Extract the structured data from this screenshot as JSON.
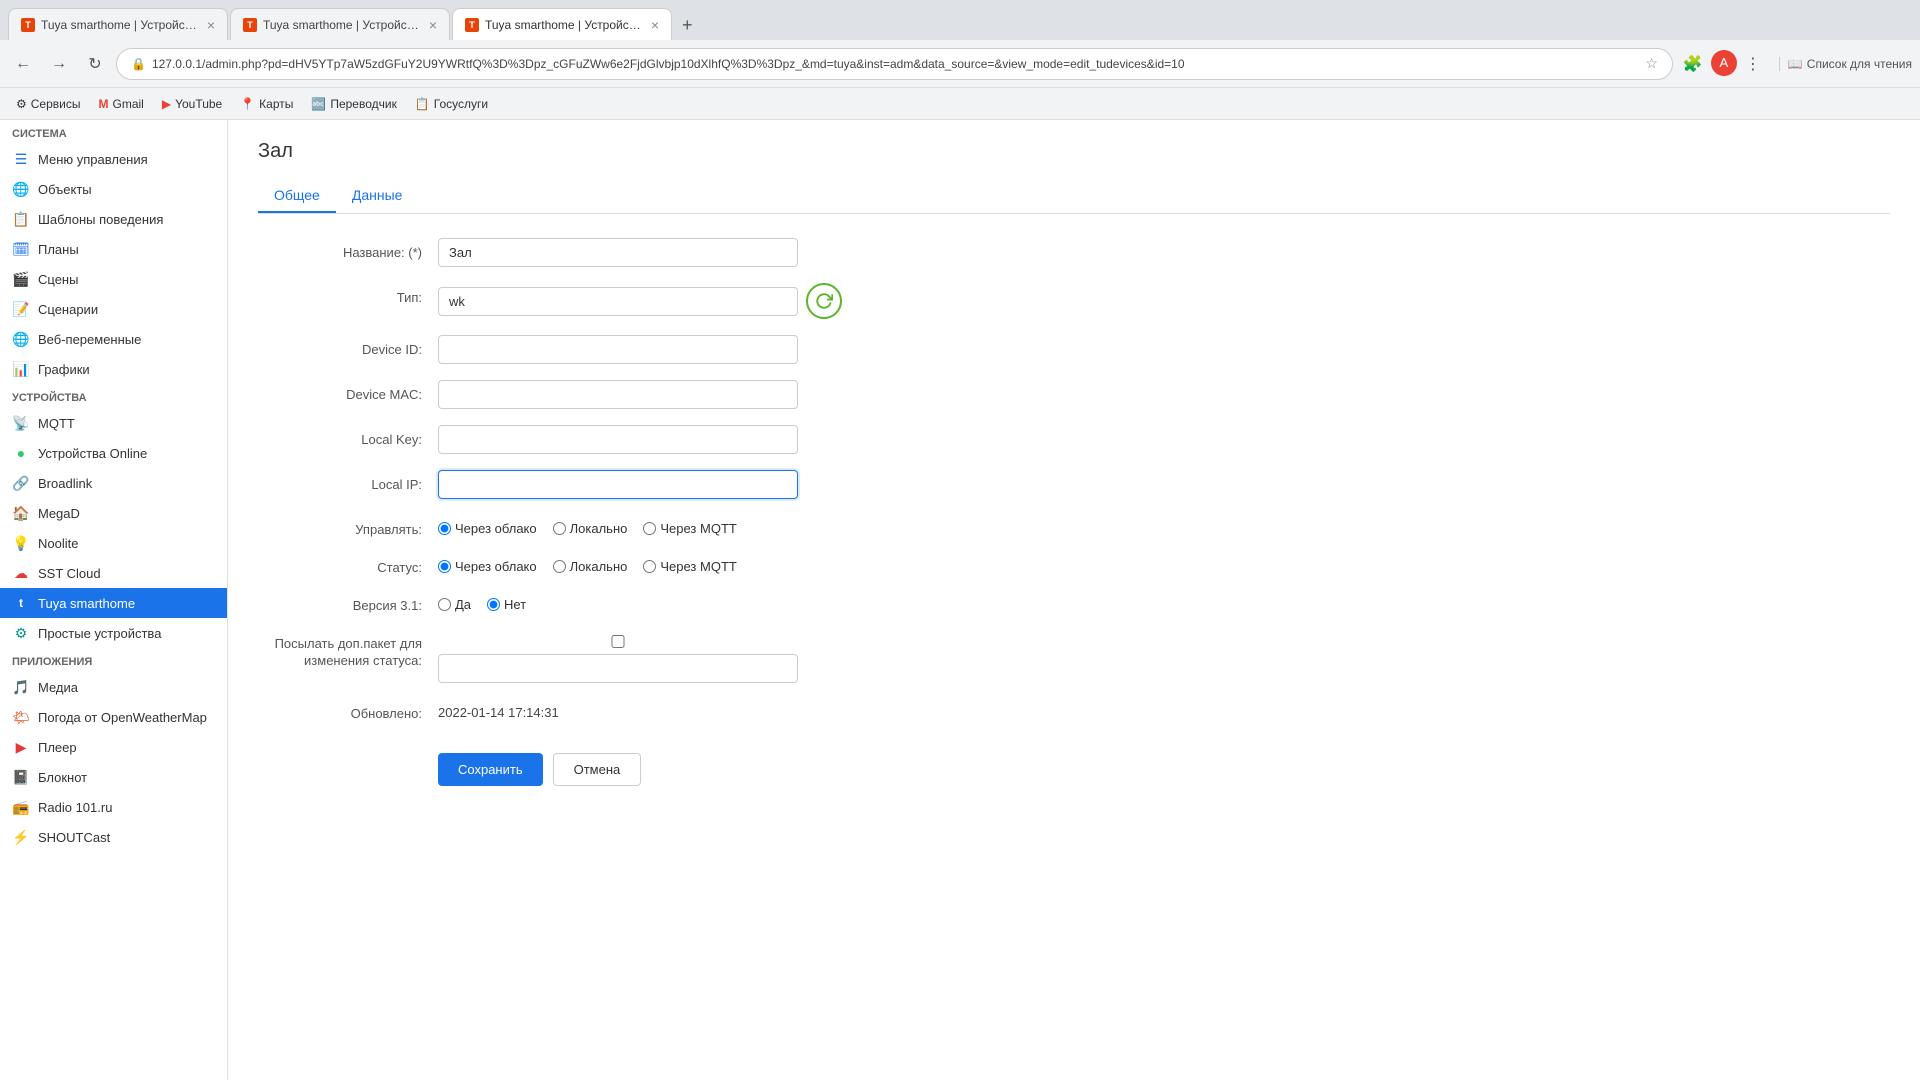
{
  "browser": {
    "tabs": [
      {
        "id": "tab1",
        "title": "Tuya smarthome | Устройства |",
        "active": false,
        "favicon": "T"
      },
      {
        "id": "tab2",
        "title": "Tuya smarthome | Устройства |",
        "active": false,
        "favicon": "T"
      },
      {
        "id": "tab3",
        "title": "Tuya smarthome | Устройства |",
        "active": true,
        "favicon": "T"
      }
    ],
    "address": "127.0.0.1/admin.php?pd=dHV5YTp7aW5zdGFuY2U9YWRtfQ%3D%3Dpz_cGFuZWw6e2FjdGlvbjp10dXlhfQ%3D%3Dpz_&md=tuya&inst=adm&data_source=&view_mode=edit_tudevices&id=10",
    "bookmarks": [
      {
        "label": "Сервисы",
        "icon": "⚙"
      },
      {
        "label": "Gmail",
        "icon": "M"
      },
      {
        "label": "YouTube",
        "icon": "▶"
      },
      {
        "label": "Карты",
        "icon": "📍"
      },
      {
        "label": "Переводчик",
        "icon": "A"
      },
      {
        "label": "Госуслуги",
        "icon": "📋"
      }
    ],
    "reading_list": "Список для чтения"
  },
  "sidebar": {
    "section_system": "Система",
    "items_system": [
      {
        "label": "Меню управления",
        "icon": "☰",
        "color": "blue"
      },
      {
        "label": "Объекты",
        "icon": "🌐",
        "color": "blue"
      },
      {
        "label": "Шаблоны поведения",
        "icon": "📋",
        "color": "blue"
      },
      {
        "label": "Планы",
        "icon": "🗓",
        "color": "blue"
      },
      {
        "label": "Сцены",
        "icon": "🎬",
        "color": "gray"
      },
      {
        "label": "Сценарии",
        "icon": "📝",
        "color": "gray"
      },
      {
        "label": "Веб-переменные",
        "icon": "🌐",
        "color": "teal"
      },
      {
        "label": "Графики",
        "icon": "📊",
        "color": "blue"
      }
    ],
    "section_devices": "Устройства",
    "items_devices": [
      {
        "label": "MQTT",
        "icon": "📡",
        "color": "blue",
        "active": false
      },
      {
        "label": "Устройства Online",
        "icon": "●",
        "color": "green",
        "active": false
      },
      {
        "label": "Broadlink",
        "icon": "🔗",
        "color": "blue",
        "active": false
      },
      {
        "label": "MegaD",
        "icon": "🏠",
        "color": "orange",
        "active": false
      },
      {
        "label": "Noolite",
        "icon": "💡",
        "color": "gray",
        "active": false
      },
      {
        "label": "SST Cloud",
        "icon": "☁",
        "color": "red",
        "active": false
      },
      {
        "label": "Tuya smarthome",
        "icon": "t",
        "color": "orange",
        "active": true
      },
      {
        "label": "Простые устройства",
        "icon": "⚙",
        "color": "teal",
        "active": false
      }
    ],
    "section_apps": "Приложения",
    "items_apps": [
      {
        "label": "Медиа",
        "icon": "🎵",
        "color": "red"
      },
      {
        "label": "Погода от OpenWeatherMap",
        "icon": "🌤",
        "color": "orange"
      },
      {
        "label": "Плеер",
        "icon": "▶",
        "color": "red"
      },
      {
        "label": "Блокнот",
        "icon": "📓",
        "color": "yellow"
      },
      {
        "label": "Radio 101.ru",
        "icon": "📻",
        "color": "blue"
      },
      {
        "label": "SHOUTCast",
        "icon": "⚡",
        "color": "blue"
      }
    ]
  },
  "main": {
    "page_title": "Зал",
    "tabs": [
      {
        "label": "Общее",
        "active": true
      },
      {
        "label": "Данные",
        "active": false
      }
    ],
    "form": {
      "name_label": "Название: (*)",
      "name_value": "Зал",
      "type_label": "Тип:",
      "type_value": "wk",
      "device_id_label": "Device ID:",
      "device_id_value": "",
      "device_mac_label": "Device MAC:",
      "device_mac_value": "",
      "local_key_label": "Local Key:",
      "local_key_value": "",
      "local_ip_label": "Local IP:",
      "local_ip_value": "",
      "manage_label": "Управлять:",
      "manage_options": [
        {
          "label": "Через облако",
          "checked": true
        },
        {
          "label": "Локально",
          "checked": false
        },
        {
          "label": "Через MQTT",
          "checked": false
        }
      ],
      "status_label": "Статус:",
      "status_options": [
        {
          "label": "Через облако",
          "checked": true
        },
        {
          "label": "Локально",
          "checked": false
        },
        {
          "label": "Через MQTT",
          "checked": false
        }
      ],
      "version_label": "Версия 3.1:",
      "version_options": [
        {
          "label": "Да",
          "checked": false
        },
        {
          "label": "Нет",
          "checked": true
        }
      ],
      "extra_packet_label": "Посылать доп.пакет для изменения статуса:",
      "extra_packet_checked": false,
      "extra_packet_value": "",
      "updated_label": "Обновлено:",
      "updated_value": "2022-01-14 17:14:31",
      "save_btn": "Сохранить",
      "cancel_btn": "Отмена"
    }
  }
}
